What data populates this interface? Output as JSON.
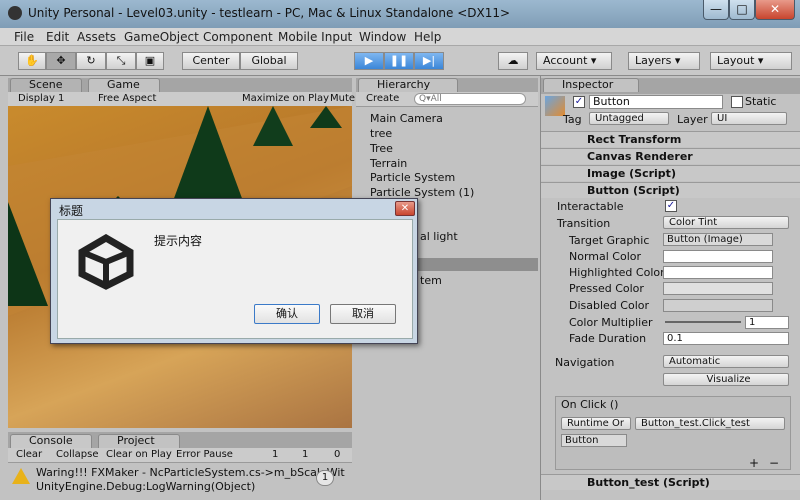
{
  "window": {
    "title": "Unity Personal - Level03.unity - testlearn - PC, Mac & Linux Standalone <DX11>"
  },
  "menu": [
    "File",
    "Edit",
    "Assets",
    "GameObject",
    "Component",
    "Mobile Input",
    "Window",
    "Help"
  ],
  "toolbar": {
    "center": "Center",
    "global": "Global",
    "account": "Account",
    "layers": "Layers",
    "layout": "Layout"
  },
  "tabs": {
    "scene": "Scene",
    "game": "Game",
    "hierarchy": "Hierarchy",
    "inspector": "Inspector",
    "console": "Console",
    "project": "Project"
  },
  "game_bar": {
    "display": "Display 1",
    "aspect": "Free Aspect",
    "maximize": "Maximize on Play",
    "mute": "Mute"
  },
  "hierarchy": {
    "create": "Create",
    "search_placeholder": "Q▾All",
    "items": [
      "Main Camera",
      "tree",
      "Tree",
      "Terrain",
      "Particle System",
      "Particle System (1)"
    ],
    "partial1": "al light",
    "partial2": "tem"
  },
  "inspector": {
    "object_name": "Button",
    "static_label": "Static",
    "tag_label": "Tag",
    "tag_value": "Untagged",
    "layer_label": "Layer",
    "layer_value": "UI",
    "components": [
      "Rect Transform",
      "Canvas Renderer",
      "Image (Script)",
      "Button (Script)"
    ],
    "interactable": "Interactable",
    "transition": "Transition",
    "transition_value": "Color Tint",
    "target_graphic": "Target Graphic",
    "target_graphic_value": "Button (Image)",
    "normal": "Normal Color",
    "highlighted": "Highlighted Color",
    "pressed": "Pressed Color",
    "disabled": "Disabled Color",
    "multiplier": "Color Multiplier",
    "multiplier_value": "1",
    "fade": "Fade Duration",
    "fade_value": "0.1",
    "navigation": "Navigation",
    "navigation_value": "Automatic",
    "visualize": "Visualize",
    "onclick": "On Click ()",
    "runtime": "Runtime Or",
    "function": "Button_test.Click_test",
    "object_ref": "Button",
    "plus": "+",
    "minus": "−",
    "script_comp": "Button_test (Script)"
  },
  "dialog": {
    "title": "标题",
    "message": "提示内容",
    "ok": "确认",
    "cancel": "取消"
  },
  "console": {
    "clear": "Clear",
    "collapse": "Collapse",
    "clear_on_play": "Clear on Play",
    "error_pause": "Error Pause",
    "count_info": "1",
    "count_warn": "1",
    "count_err": "0",
    "line1": "Waring!!! FXMaker - NcParticleSystem.cs->m_bScaleWit",
    "line2": "UnityEngine.Debug:LogWarning(Object)",
    "badge": "1"
  }
}
